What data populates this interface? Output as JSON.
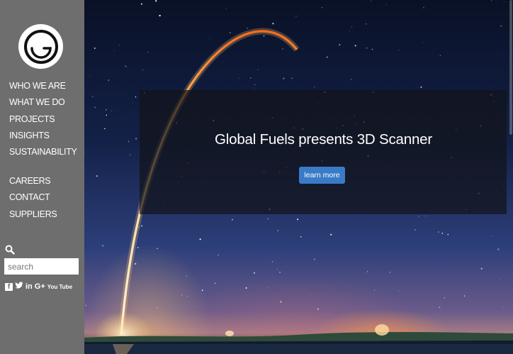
{
  "brand": {
    "logo_icon": "globe-logo-icon"
  },
  "nav": {
    "primary": [
      "WHO WE ARE",
      "WHAT WE DO",
      "PROJECTS",
      "INSIGHTS",
      "SUSTAINABILITY"
    ],
    "secondary": [
      "CAREERS",
      "CONTACT",
      "SUPPLIERS"
    ]
  },
  "search": {
    "placeholder": "search",
    "icon": "search-icon"
  },
  "socials": {
    "facebook": "f",
    "twitter_icon": "twitter-icon",
    "linkedin": "in",
    "googleplus": "G+",
    "youtube": "You Tube"
  },
  "hero": {
    "headline": "Global Fuels presents 3D Scanner",
    "cta_label": "learn more"
  },
  "colors": {
    "sidebar": "#6e6e6e",
    "button": "#3a7bc8",
    "overlay": "rgba(18,20,26,0.72)"
  }
}
